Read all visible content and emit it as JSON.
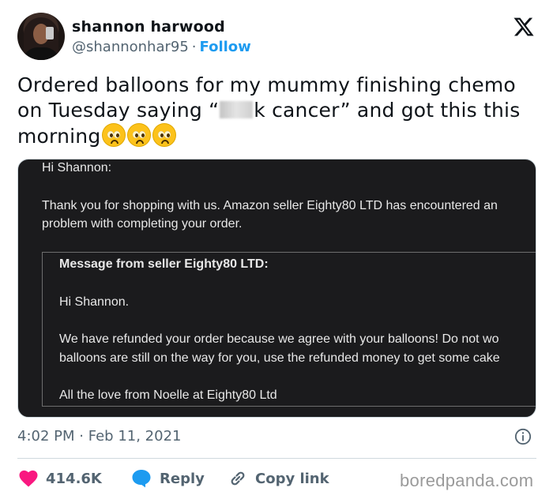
{
  "author": {
    "name": "shannon harwood",
    "handle": "@shannonhar95",
    "separator": "·",
    "follow_label": "Follow"
  },
  "tweet": {
    "text_before": "Ordered balloons for my mummy finishing chemo on Tuesday saying “",
    "text_after": "k cancer” and got this this morning",
    "emojis": [
      "pleading-face",
      "pleading-face",
      "pleading-face"
    ]
  },
  "email": {
    "greeting": "Hi Shannon:",
    "line1": "Thank you for shopping with us. Amazon seller Eighty80 LTD has encountered an",
    "line2": "problem with completing your order.",
    "seller_header": "Message from seller Eighty80 LTD:",
    "seller_greeting": "Hi Shannon.",
    "seller_line1": "We have refunded your order because we agree with your balloons! Do not wo",
    "seller_line2": "balloons are still on the way for you, use the refunded money to get some cake",
    "signoff": "All the love from Noelle at Eighty80 Ltd"
  },
  "meta": {
    "time": "4:02 PM",
    "separator": "·",
    "date": "Feb 11, 2021"
  },
  "actions": {
    "like_count": "414.6K",
    "reply_label": "Reply",
    "copy_link_label": "Copy link"
  },
  "watermark": "boredpanda.com",
  "colors": {
    "accent": "#1d9bf0",
    "like": "#f91880",
    "muted": "#536471",
    "text": "#0f1419"
  }
}
